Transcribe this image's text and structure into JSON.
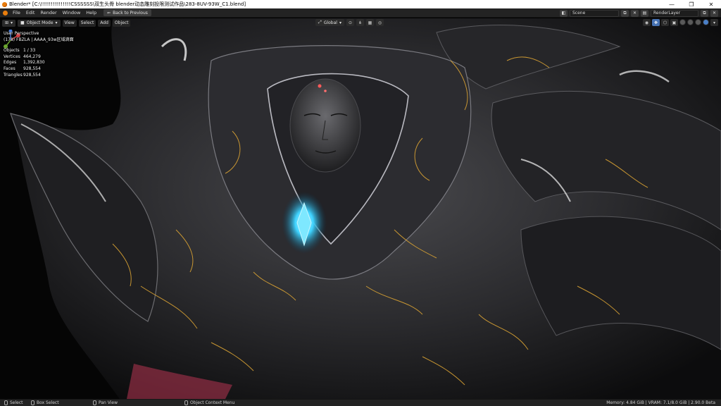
{
  "titlebar": {
    "title": "Blender* [C:\\!!!!!!!!!!!!!!!CSSSSSS\\双生头骨  blender动态雕刻投限测试作品\\283-8UV-93W_C1.blend]",
    "app_icon": "blender-logo-icon",
    "minimize": "—",
    "maximize": "❐",
    "close": "✕"
  },
  "menubar": {
    "items": [
      "File",
      "Edit",
      "Render",
      "Window",
      "Help"
    ],
    "back_button": "Back to Previous",
    "scene": "Scene",
    "render_layer": "RenderLayer"
  },
  "viewport_header": {
    "mode": "Object Mode",
    "menus": [
      "View",
      "Select",
      "Add",
      "Object"
    ],
    "transform_orientation": "Global"
  },
  "overlay": {
    "perspective": "User Perspective",
    "collection": "(178) FBZLA | AAAA_93w区域滴面",
    "stats": [
      {
        "label": "Objects",
        "value": "1 / 33"
      },
      {
        "label": "Vertices",
        "value": "464,279"
      },
      {
        "label": "Edges",
        "value": "1,392,830"
      },
      {
        "label": "Faces",
        "value": "928,554"
      },
      {
        "label": "Triangles",
        "value": "928,554"
      }
    ]
  },
  "statusbar": {
    "select": "Select",
    "box_select": "Box Select",
    "pan_view": "Pan View",
    "context_menu": "Object Context Menu",
    "stats": "Memory: 4.84 GiB | VRAM: 7.1/8.0 GiB | 2.90.0 Beta"
  },
  "colors": {
    "accent": "#e87d0d",
    "selected": "#4772b3",
    "gold": "#d9a233",
    "gem": "#3fd3ff"
  }
}
